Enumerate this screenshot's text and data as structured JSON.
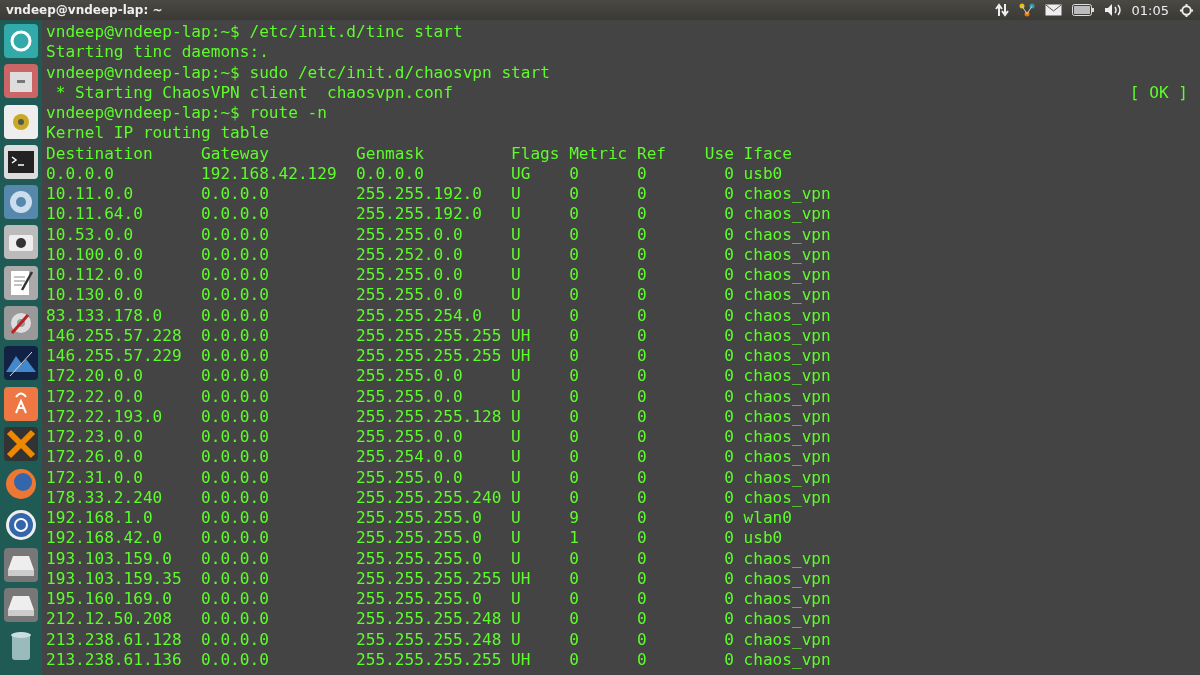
{
  "top_panel": {
    "title": "vndeep@vndeep-lap: ~",
    "clock": "01:05"
  },
  "terminal": {
    "lines": [
      {
        "text": "vndeep@vndeep-lap:~$ /etc/init.d/tinc start"
      },
      {
        "text": "Starting tinc daemons:."
      },
      {
        "text": "vndeep@vndeep-lap:~$ sudo /etc/init.d/chaosvpn start"
      },
      {
        "text": " * Starting ChaosVPN client  chaosvpn.conf",
        "status": "[ OK ]"
      },
      {
        "text": "vndeep@vndeep-lap:~$ route -n"
      },
      {
        "text": "Kernel IP routing table"
      }
    ],
    "route_table": {
      "columns": [
        "Destination",
        "Gateway",
        "Genmask",
        "Flags",
        "Metric",
        "Ref",
        "Use",
        "Iface"
      ],
      "rows": [
        [
          "0.0.0.0",
          "192.168.42.129",
          "0.0.0.0",
          "UG",
          "0",
          "0",
          "0",
          "usb0"
        ],
        [
          "10.11.0.0",
          "0.0.0.0",
          "255.255.192.0",
          "U",
          "0",
          "0",
          "0",
          "chaos_vpn"
        ],
        [
          "10.11.64.0",
          "0.0.0.0",
          "255.255.192.0",
          "U",
          "0",
          "0",
          "0",
          "chaos_vpn"
        ],
        [
          "10.53.0.0",
          "0.0.0.0",
          "255.255.0.0",
          "U",
          "0",
          "0",
          "0",
          "chaos_vpn"
        ],
        [
          "10.100.0.0",
          "0.0.0.0",
          "255.252.0.0",
          "U",
          "0",
          "0",
          "0",
          "chaos_vpn"
        ],
        [
          "10.112.0.0",
          "0.0.0.0",
          "255.255.0.0",
          "U",
          "0",
          "0",
          "0",
          "chaos_vpn"
        ],
        [
          "10.130.0.0",
          "0.0.0.0",
          "255.255.0.0",
          "U",
          "0",
          "0",
          "0",
          "chaos_vpn"
        ],
        [
          "83.133.178.0",
          "0.0.0.0",
          "255.255.254.0",
          "U",
          "0",
          "0",
          "0",
          "chaos_vpn"
        ],
        [
          "146.255.57.228",
          "0.0.0.0",
          "255.255.255.255",
          "UH",
          "0",
          "0",
          "0",
          "chaos_vpn"
        ],
        [
          "146.255.57.229",
          "0.0.0.0",
          "255.255.255.255",
          "UH",
          "0",
          "0",
          "0",
          "chaos_vpn"
        ],
        [
          "172.20.0.0",
          "0.0.0.0",
          "255.255.0.0",
          "U",
          "0",
          "0",
          "0",
          "chaos_vpn"
        ],
        [
          "172.22.0.0",
          "0.0.0.0",
          "255.255.0.0",
          "U",
          "0",
          "0",
          "0",
          "chaos_vpn"
        ],
        [
          "172.22.193.0",
          "0.0.0.0",
          "255.255.255.128",
          "U",
          "0",
          "0",
          "0",
          "chaos_vpn"
        ],
        [
          "172.23.0.0",
          "0.0.0.0",
          "255.255.0.0",
          "U",
          "0",
          "0",
          "0",
          "chaos_vpn"
        ],
        [
          "172.26.0.0",
          "0.0.0.0",
          "255.254.0.0",
          "U",
          "0",
          "0",
          "0",
          "chaos_vpn"
        ],
        [
          "172.31.0.0",
          "0.0.0.0",
          "255.255.0.0",
          "U",
          "0",
          "0",
          "0",
          "chaos_vpn"
        ],
        [
          "178.33.2.240",
          "0.0.0.0",
          "255.255.255.240",
          "U",
          "0",
          "0",
          "0",
          "chaos_vpn"
        ],
        [
          "192.168.1.0",
          "0.0.0.0",
          "255.255.255.0",
          "U",
          "9",
          "0",
          "0",
          "wlan0"
        ],
        [
          "192.168.42.0",
          "0.0.0.0",
          "255.255.255.0",
          "U",
          "1",
          "0",
          "0",
          "usb0"
        ],
        [
          "193.103.159.0",
          "0.0.0.0",
          "255.255.255.0",
          "U",
          "0",
          "0",
          "0",
          "chaos_vpn"
        ],
        [
          "193.103.159.35",
          "0.0.0.0",
          "255.255.255.255",
          "UH",
          "0",
          "0",
          "0",
          "chaos_vpn"
        ],
        [
          "195.160.169.0",
          "0.0.0.0",
          "255.255.255.0",
          "U",
          "0",
          "0",
          "0",
          "chaos_vpn"
        ],
        [
          "212.12.50.208",
          "0.0.0.0",
          "255.255.255.248",
          "U",
          "0",
          "0",
          "0",
          "chaos_vpn"
        ],
        [
          "213.238.61.128",
          "0.0.0.0",
          "255.255.255.248",
          "U",
          "0",
          "0",
          "0",
          "chaos_vpn"
        ],
        [
          "213.238.61.136",
          "0.0.0.0",
          "255.255.255.255",
          "UH",
          "0",
          "0",
          "0",
          "chaos_vpn"
        ]
      ]
    }
  }
}
